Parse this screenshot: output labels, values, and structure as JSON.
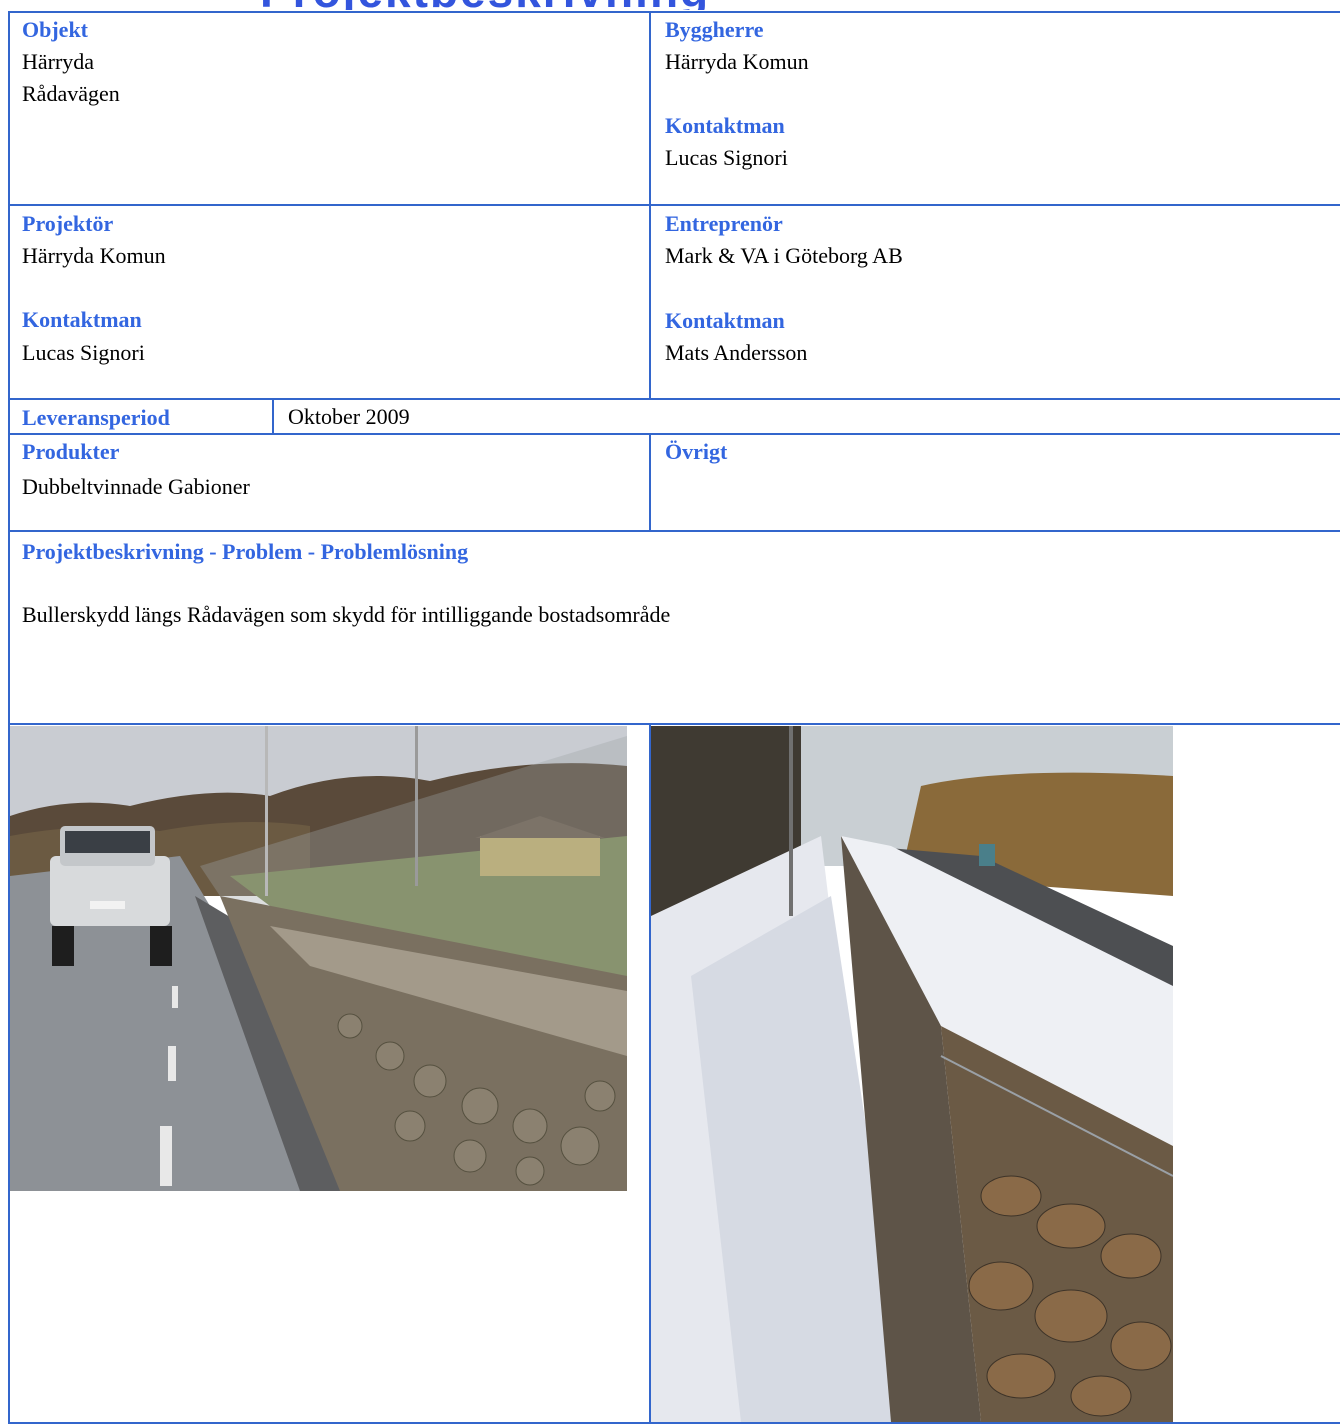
{
  "header": {
    "title_fragment": "Projektbeskrivning"
  },
  "objekt": {
    "label": "Objekt",
    "line1": "Härryda",
    "line2": "Rådavägen"
  },
  "byggherre": {
    "label": "Byggherre",
    "value": "Härryda Komun",
    "contact_label": "Kontaktman",
    "contact_value": "Lucas Signori"
  },
  "projektor": {
    "label": "Projektör",
    "value": "Härryda Komun",
    "contact_label": "Kontaktman",
    "contact_value": "Lucas Signori"
  },
  "entreprenor": {
    "label": "Entreprenör",
    "value": "Mark & VA i Göteborg AB",
    "contact_label": "Kontaktman",
    "contact_value": "Mats Andersson"
  },
  "leveransperiod": {
    "label": "Leveransperiod",
    "value": "Oktober 2009"
  },
  "produkter": {
    "label": "Produkter",
    "value": "Dubbeltvinnade Gabioner"
  },
  "ovrigt": {
    "label": "Övrigt",
    "value": ""
  },
  "beskrivning": {
    "label": "Projektbeskrivning - Problem - Problemlösning",
    "text": "Bullerskydd längs Rådavägen som skydd för intilliggande bostadsområde"
  },
  "colors": {
    "label_blue": "#3366e0",
    "rule_blue": "#3366cc"
  },
  "photos": [
    {
      "subject": "gabion wall along road with pickup truck, autumn"
    },
    {
      "subject": "gabion wall along road in snow, winter"
    }
  ]
}
